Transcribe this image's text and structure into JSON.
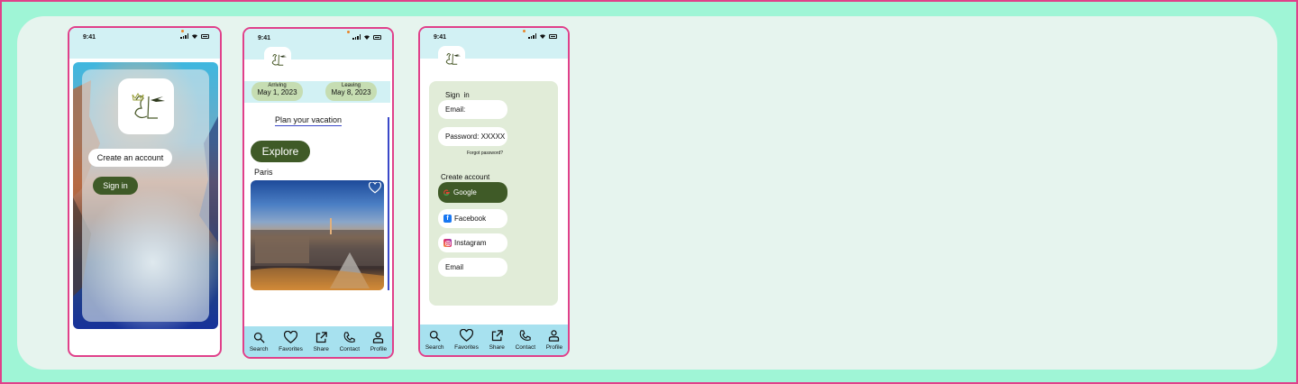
{
  "status_bar": {
    "time": "9:41"
  },
  "screen_welcome": {
    "create_account_label": "Create an account",
    "sign_in_label": "Sign in"
  },
  "screen_home": {
    "arriving_label": "Arriving",
    "arriving_date": "May 1, 2023",
    "leaving_label": "Leaving",
    "leaving_date": "May 8, 2023",
    "plan_link": "Plan your vacation",
    "explore_label": "Explore",
    "city_name": "Paris"
  },
  "screen_login": {
    "sign_in_heading": "Sign  in",
    "email_label": "Email:",
    "password_label": "Password: XXXXX",
    "forgot_password": "Forgot password?",
    "create_account_heading": "Create account",
    "google_label": "Google",
    "facebook_label": "Facebook",
    "instagram_label": "Instagram",
    "email_option_label": "Email"
  },
  "nav": {
    "search": "Search",
    "favorites": "Favorites",
    "share": "Share",
    "contact": "Contact",
    "profile": "Profile"
  },
  "colors": {
    "accent_pink": "#e0408a",
    "brand_green": "#3f5a27",
    "status_bar": "#d2f1f4",
    "nav_bar": "#a7e1ef",
    "date_pill": "#c6ddb2",
    "login_card": "#e1ecd8"
  }
}
